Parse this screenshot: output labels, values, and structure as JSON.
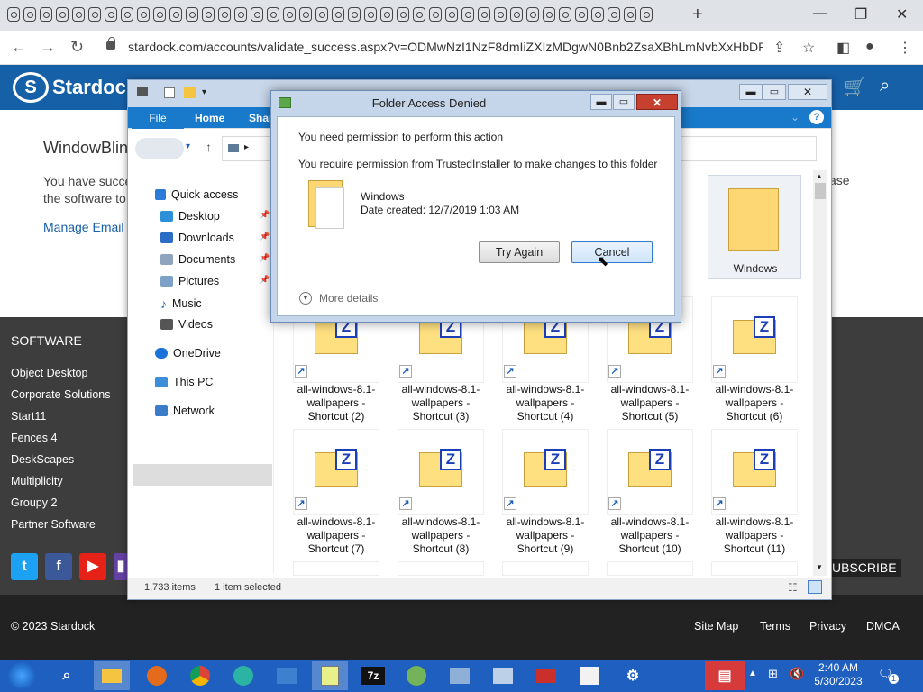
{
  "browser": {
    "url": "stardock.com/accounts/validate_success.aspx?v=ODMwNzI1NzF8dmIiZXIzMDgwN0Bnb2ZsaXBhLmNvbXxHbDR..."
  },
  "site": {
    "logo_text": "Stardock",
    "heading": "WindowBlin",
    "body_line1": "You have succe",
    "body_line2": "the software to",
    "body_right": "ase",
    "manage_link": "Manage Email",
    "software_title": "SOFTWARE",
    "software_items": [
      "Object Desktop",
      "Corporate Solutions",
      "Start11",
      "Fences 4",
      "DeskScapes",
      "Multiplicity",
      "Groupy 2",
      "Partner Software"
    ],
    "subscribe": "UBSCRIBE",
    "copyright": "© 2023 Stardock",
    "footer_links": [
      "Site Map",
      "Terms",
      "Privacy",
      "DMCA"
    ]
  },
  "explorer": {
    "tab_file": "File",
    "tab_home": "Home",
    "tab_share": "Shar",
    "nav": [
      "Quick access",
      "Desktop",
      "Downloads",
      "Documents",
      "Pictures",
      "Music",
      "Videos",
      "OneDrive",
      "This PC",
      "Network"
    ],
    "status_items": "1,733 items",
    "status_selected": "1 item selected",
    "windows_folder": "Windows",
    "files": [
      [
        "all-windows-8.1-",
        "wallpapers -",
        "Shortcut (2)"
      ],
      [
        "all-windows-8.1-",
        "wallpapers -",
        "Shortcut (3)"
      ],
      [
        "all-windows-8.1-",
        "wallpapers -",
        "Shortcut (4)"
      ],
      [
        "all-windows-8.1-",
        "wallpapers -",
        "Shortcut (5)"
      ],
      [
        "all-windows-8.1-",
        "wallpapers -",
        "Shortcut (6)"
      ],
      [
        "all-windows-8.1-",
        "wallpapers -",
        "Shortcut (7)"
      ],
      [
        "all-windows-8.1-",
        "wallpapers -",
        "Shortcut (8)"
      ],
      [
        "all-windows-8.1-",
        "wallpapers -",
        "Shortcut (9)"
      ],
      [
        "all-windows-8.1-",
        "wallpapers -",
        "Shortcut (10)"
      ],
      [
        "all-windows-8.1-",
        "wallpapers -",
        "Shortcut (11)"
      ]
    ]
  },
  "dialog": {
    "title": "Folder Access Denied",
    "line1": "You need permission to perform this action",
    "line2": "You require permission from TrustedInstaller to make changes to this folder",
    "item_name": "Windows",
    "item_date": "Date created: 12/7/2019 1:03 AM",
    "try_again": "Try Again",
    "cancel": "Cancel",
    "more_details": "More details"
  },
  "taskbar": {
    "time": "2:40 AM",
    "date": "5/30/2023",
    "notifications": "1"
  }
}
